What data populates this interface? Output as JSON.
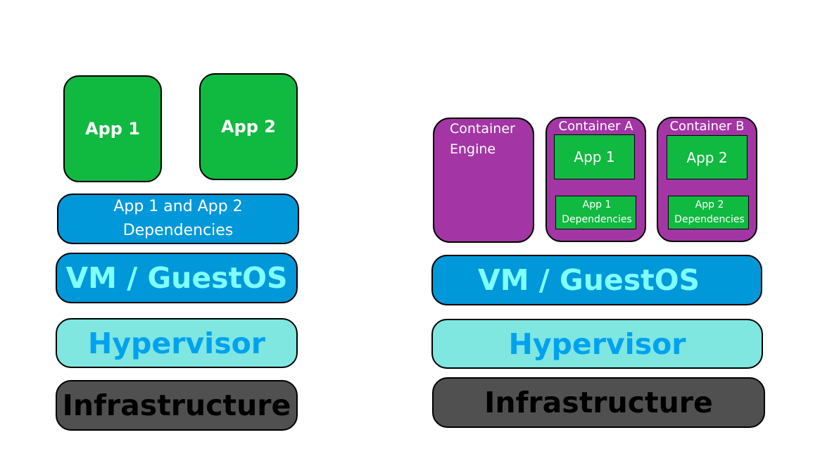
{
  "left_stack": {
    "apps": [
      {
        "label": "App 1"
      },
      {
        "label": "App 2"
      }
    ],
    "dependencies": {
      "line1": "App 1 and App 2",
      "line2": "Dependencies"
    },
    "vm": "VM / GuestOS",
    "hypervisor": "Hypervisor",
    "infrastructure": "Infrastructure"
  },
  "right_stack": {
    "container_engine": {
      "line1": "Container",
      "line2": "Engine"
    },
    "containers": [
      {
        "title": "Container A",
        "app": "App 1",
        "deps_line1": "App 1",
        "deps_line2": "Dependencies"
      },
      {
        "title": "Container B",
        "app": "App 2",
        "deps_line1": "App 2",
        "deps_line2": "Dependencies"
      }
    ],
    "vm": "VM / GuestOS",
    "hypervisor": "Hypervisor",
    "infrastructure": "Infrastructure"
  },
  "colors": {
    "app_green": "#10b940",
    "vm_blue": "#0098d9",
    "vm_text": "#80ffff",
    "hypervisor_cyan": "#7fe6e0",
    "hypervisor_text": "#00a2f0",
    "infrastructure_gray": "#505050",
    "container_purple": "#a336a4"
  }
}
